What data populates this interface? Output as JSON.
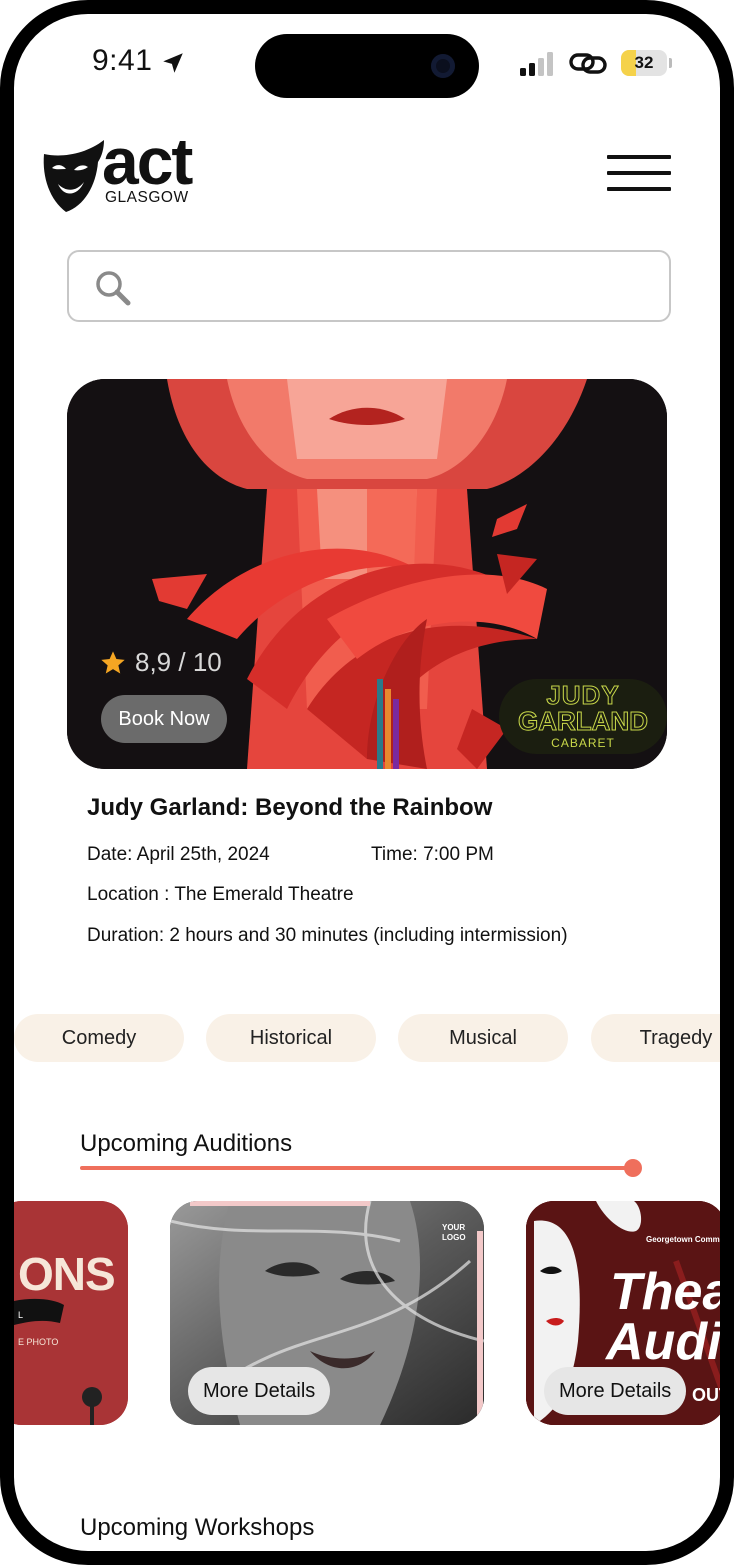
{
  "status_bar": {
    "time": "9:41",
    "battery": "32",
    "battery_level": 0.32
  },
  "header": {
    "logo_word": "act",
    "logo_sub": "GLASGOW"
  },
  "search": {
    "placeholder": "",
    "value": ""
  },
  "featured": {
    "rating": "8,9 / 10",
    "book_label": "Book Now",
    "poster_logo_line1": "JUDY",
    "poster_logo_line2": "GARLAND",
    "poster_logo_line3": "CABARET"
  },
  "show": {
    "title": "Judy Garland: Beyond the Rainbow",
    "date": "Date: April 25th, 2024",
    "time": "Time: 7:00 PM",
    "location": "Location : The Emerald Theatre",
    "duration": "Duration: 2 hours and 30 minutes (including intermission)"
  },
  "genres": [
    "Comedy",
    "Historical",
    "Musical",
    "Tragedy"
  ],
  "auditions": {
    "title": "Upcoming Auditions",
    "card1_text": "ONS",
    "card1_small1": "L",
    "card1_small2": "E PHOTO",
    "card2_logo": "YOUR LOGO",
    "card3_org": "Georgetown Community Thea",
    "card3_title1": "Theat",
    "card3_title2": "Auditi",
    "card3_tail": "OUT",
    "more_label": "More Details"
  },
  "workshops": {
    "title": "Upcoming Workshops"
  },
  "colors": {
    "accent": "#ef6f5c",
    "chip_bg": "#f9f1e7",
    "star": "#f5a623"
  }
}
